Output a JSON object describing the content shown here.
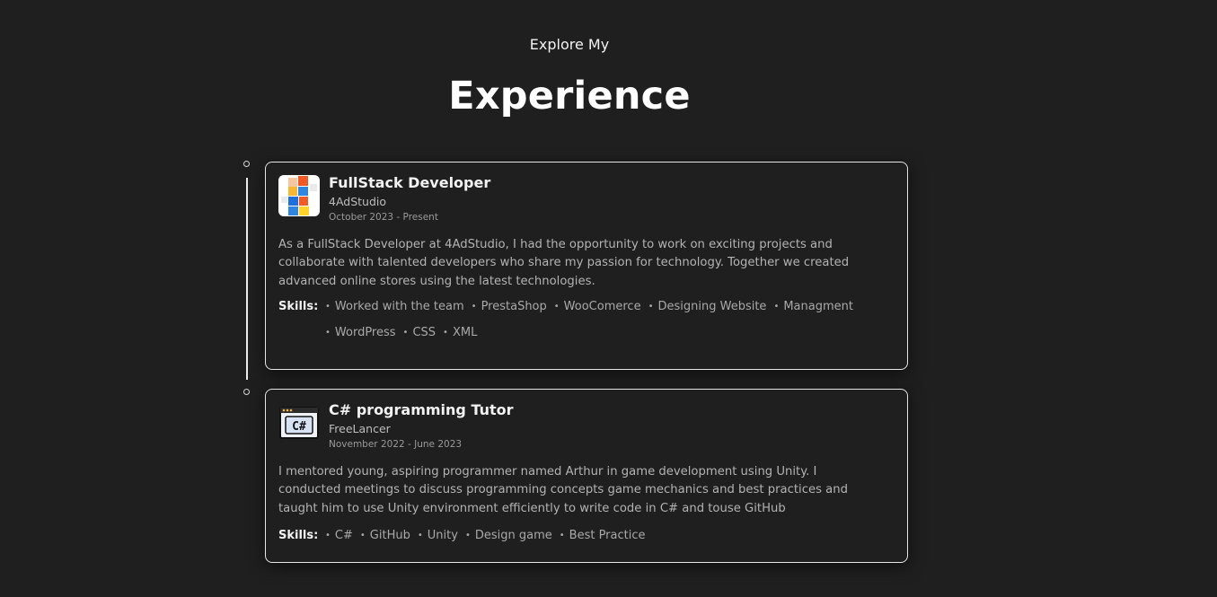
{
  "section": {
    "subtitle": "Explore My",
    "title": "Experience"
  },
  "experiences": [
    {
      "title": "FullStack Developer",
      "company": "4AdStudio",
      "dates": "October 2023 - Present",
      "description": "As a FullStack Developer at 4AdStudio, I had the opportunity to work on exciting projects and collaborate with talented developers who share my passion for technology. Together we created advanced online stores using the latest technologies.",
      "skills_label": "Skills:",
      "skills": [
        "Worked with the team",
        "PrestaShop",
        "WooComerce",
        "Designing Website",
        "Managment",
        "WordPress",
        "CSS",
        "XML"
      ],
      "logo_icon": "4adstudio-logo-icon"
    },
    {
      "title": "C# programming Tutor",
      "company": "FreeLancer",
      "dates": "November 2022 - June 2023",
      "description": "I mentored young, aspiring programmer named Arthur in game development using Unity. I conducted meetings to discuss programming concepts game mechanics and best practices and taught him to use Unity environment efficiently to write code in C# and touse GitHub",
      "skills_label": "Skills:",
      "skills": [
        "C#",
        "GitHub",
        "Unity",
        "Design game",
        "Best Practice"
      ],
      "logo_icon": "csharp-window-icon"
    }
  ],
  "colors": {
    "background": "#1f1f1f",
    "card_border": "#e6e6e6",
    "text_primary": "#f2f2f2",
    "text_muted": "#b3b3b3"
  }
}
